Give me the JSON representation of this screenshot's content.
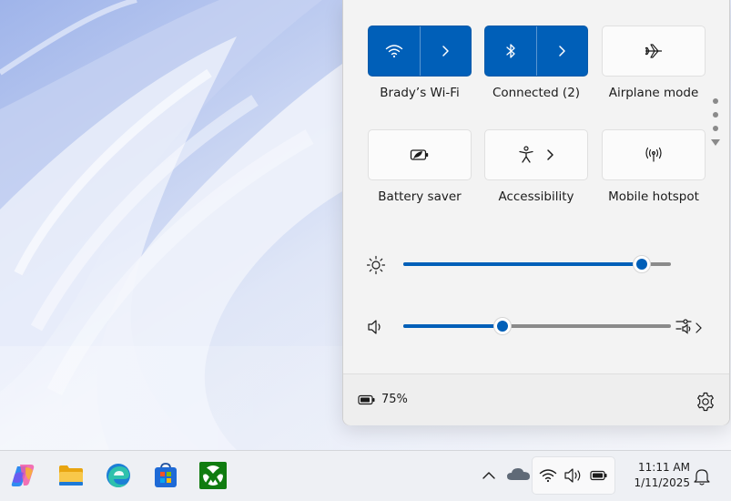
{
  "quick_settings": {
    "tiles": [
      {
        "id": "wifi",
        "label": "Brady’s Wi-Fi",
        "active": true,
        "icon": "wifi-icon",
        "has_expand": true
      },
      {
        "id": "bluetooth",
        "label": "Connected (2)",
        "active": true,
        "icon": "bluetooth-icon",
        "has_expand": true
      },
      {
        "id": "airplane",
        "label": "Airplane mode",
        "active": false,
        "icon": "airplane-icon",
        "has_expand": false
      },
      {
        "id": "battery_saver",
        "label": "Battery saver",
        "active": false,
        "icon": "battery-saver-icon",
        "has_expand": false
      },
      {
        "id": "accessibility",
        "label": "Accessibility",
        "active": false,
        "icon": "accessibility-icon",
        "has_expand": true
      },
      {
        "id": "hotspot",
        "label": "Mobile hotspot",
        "active": false,
        "icon": "mobile-hotspot-icon",
        "has_expand": false
      }
    ],
    "page_indicator": {
      "pages": 3,
      "current": 0
    },
    "brightness": {
      "value": 0.89,
      "icon": "brightness-icon"
    },
    "volume": {
      "value": 0.37,
      "icon": "speaker-icon",
      "output_icon": "sound-output-icon"
    },
    "footer": {
      "battery_percent": "75%",
      "battery_icon": "battery-icon",
      "settings_icon": "gear-icon"
    }
  },
  "taskbar": {
    "apps": [
      {
        "name": "Copilot",
        "icon": "copilot-icon"
      },
      {
        "name": "File Explorer",
        "icon": "folder-icon"
      },
      {
        "name": "Microsoft Edge",
        "icon": "edge-icon"
      },
      {
        "name": "Microsoft Store",
        "icon": "store-icon"
      },
      {
        "name": "Xbox",
        "icon": "xbox-icon"
      }
    ],
    "tray": {
      "time": "11:11 AM",
      "date": "1/11/2025"
    }
  },
  "colors": {
    "accent": "#005fb8",
    "panel_bg": "#f3f3f3",
    "taskbar_bg": "#eef0f4"
  }
}
